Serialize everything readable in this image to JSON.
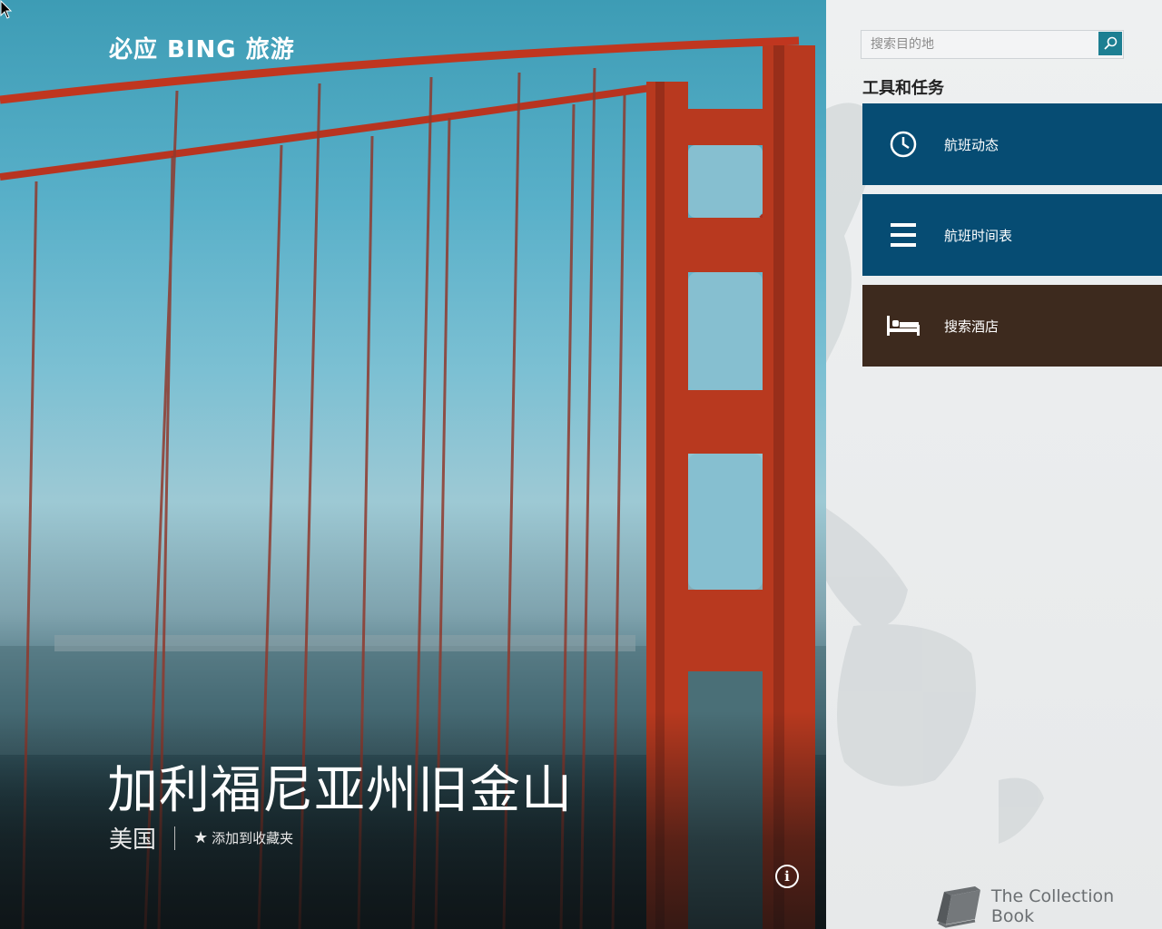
{
  "hero": {
    "brand": "必应 BING 旅游",
    "city": "加利福尼亚州旧金山",
    "country": "美国",
    "favorite_label": "添加到收藏夹"
  },
  "sidebar": {
    "search_placeholder": "搜索目的地",
    "section_title": "工具和任务",
    "tiles": [
      {
        "label": "航班动态",
        "icon": "clock-icon",
        "color": "#064c73"
      },
      {
        "label": "航班时间表",
        "icon": "list-icon",
        "color": "#064c73"
      },
      {
        "label": "搜索酒店",
        "icon": "bed-icon",
        "color": "#3d2a1e"
      }
    ],
    "footer": "The Collection Book"
  },
  "colors": {
    "accent": "#1d7f92",
    "tile_blue": "#064c73",
    "tile_brown": "#3d2a1e"
  }
}
